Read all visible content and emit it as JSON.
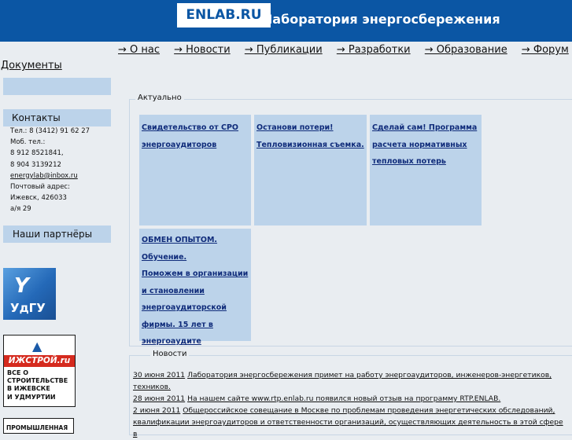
{
  "header": {
    "logo": "ENLAB.RU",
    "title": "Лаборатория энергосбережения"
  },
  "nav": {
    "items": [
      {
        "label": "→ О нас"
      },
      {
        "label": "→ Новости"
      },
      {
        "label": "→ Публикации"
      },
      {
        "label": "→ Разработки"
      },
      {
        "label": "→ Образование"
      },
      {
        "label": "→ Форум"
      },
      {
        "label": "→"
      }
    ],
    "second_row": "Документы"
  },
  "sidebar": {
    "contacts_heading": "Контакты",
    "contacts_lines": [
      "Тел.: 8 (3412) 91 62 27",
      "Моб. тел.:",
      "8 912 8521841,",
      "8 904 3139212"
    ],
    "email": "energylab@inbox.ru",
    "address_lines": [
      "Почтовый адрес:",
      "Ижевск, 426033",
      "а/я 29"
    ],
    "partners_heading": "Наши партнёры",
    "partners": {
      "udgu": "УдГУ",
      "izh_band": "ИЖСТРОЙ.ru",
      "izh_lines": [
        "ВСЕ О",
        "СТРОИТЕЛЬСТВЕ",
        "В ИЖЕВСКЕ",
        "И УДМУРТИИ"
      ],
      "prom": "ПРОМЫШЛЕННАЯ"
    }
  },
  "actual": {
    "legend": "Актуально",
    "cards": [
      {
        "lines": [
          "Свидетельство от СРО",
          "энергоаудиторов"
        ]
      },
      {
        "lines": [
          "Останови потери!",
          "Тепловизионная съемка."
        ]
      },
      {
        "lines": [
          "Сделай сам! Программа",
          "расчета нормативных",
          "тепловых потерь"
        ]
      },
      {
        "lines": [
          "ОБМЕН ОПЫТОМ.",
          "Обучение. ",
          "Поможем в организации",
          "и становлении",
          "энергоаудиторской",
          "фирмы. 15 лет в",
          "энергоаудите"
        ]
      }
    ]
  },
  "news": {
    "legend": "Новости",
    "items": [
      {
        "date": "30 июня 2011",
        "text": "Лаборатория энергосбережения примет на работу энергоаудиторов, инженеров-энергетиков,",
        "text2": "техников."
      },
      {
        "date": "28 июня 2011",
        "text": "На нашем сайте www.rtp.enlab.ru появился новый отзыв на программу RTP.ENLAB.",
        "text2": ""
      },
      {
        "date": "2 июня 2011",
        "text": "Общероссийское совещание в Москве по проблемам проведения энергетических обследований,",
        "text2": "квалификации энергоаудиторов и ответственности организаций, осуществляющих деятельность в этой сфере в"
      }
    ]
  }
}
